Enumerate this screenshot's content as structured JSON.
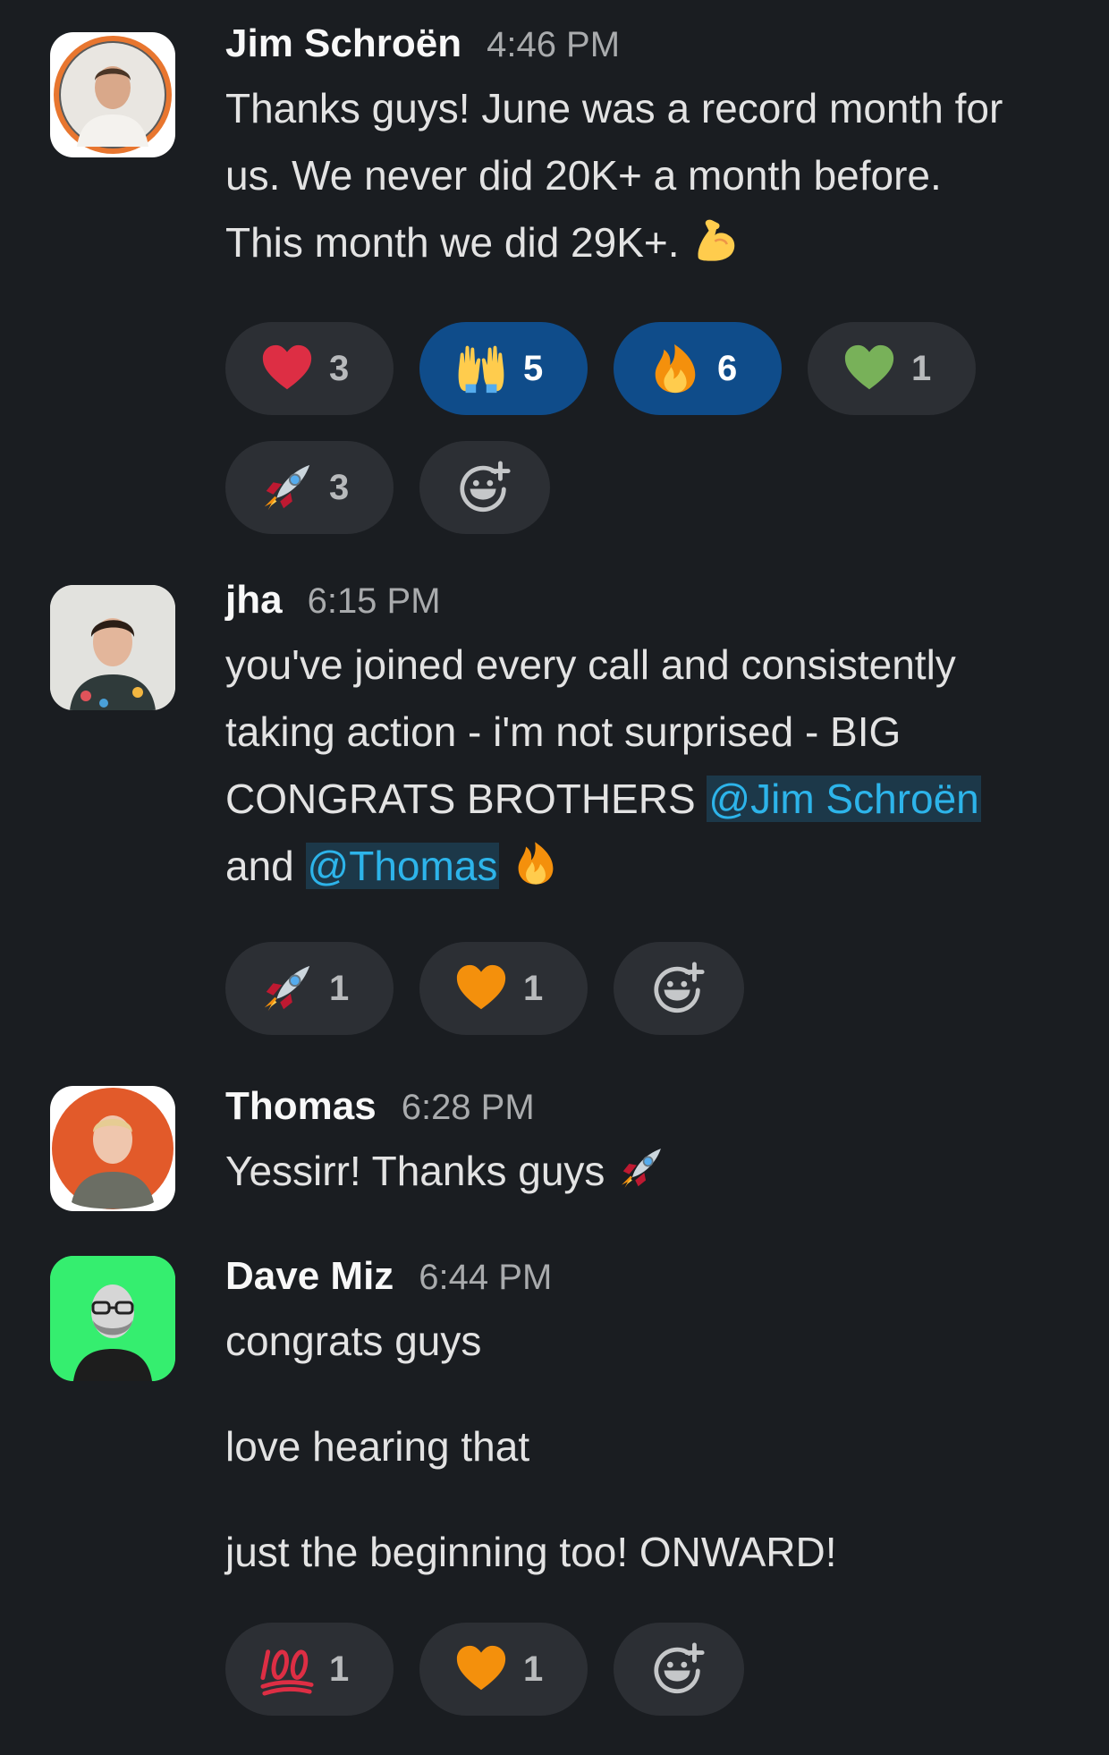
{
  "messages": [
    {
      "author": "Jim Schroën",
      "time": "4:46 PM",
      "lines": [
        "Thanks guys! June was a record month for",
        "us. We never did 20K+ a month before.",
        "This month we did 29K+."
      ],
      "trailing_emoji": "flexed-biceps",
      "reactions": [
        {
          "emoji": "red-heart",
          "count": "3",
          "active": false
        },
        {
          "emoji": "raising-hands",
          "count": "5",
          "active": true
        },
        {
          "emoji": "fire",
          "count": "6",
          "active": true
        },
        {
          "emoji": "green-heart",
          "count": "1",
          "active": false
        },
        {
          "emoji": "rocket",
          "count": "3",
          "active": false
        }
      ]
    },
    {
      "author": "jha",
      "time": "6:15 PM",
      "lines": [
        "you've joined every call and consistently",
        "taking action - i'm not surprised - BIG",
        "CONGRATS BROTHERS"
      ],
      "mention_1": "@Jim Schroën",
      "line_4_prefix": "and",
      "mention_2": "@Thomas",
      "trailing_emoji": "fire",
      "reactions": [
        {
          "emoji": "rocket",
          "count": "1",
          "active": false
        },
        {
          "emoji": "orange-heart",
          "count": "1",
          "active": false
        }
      ]
    },
    {
      "author": "Thomas",
      "time": "6:28 PM",
      "lines": [
        "Yessirr! Thanks guys"
      ],
      "trailing_emoji": "rocket"
    },
    {
      "author": "Dave Miz",
      "time": "6:44 PM",
      "lines": [
        "congrats guys",
        "love hearing that",
        "just the beginning too!  ONWARD!"
      ],
      "reactions": [
        {
          "emoji": "hundred-points",
          "count": "1",
          "active": false
        },
        {
          "emoji": "orange-heart",
          "count": "1",
          "active": false
        }
      ]
    }
  ],
  "add_reaction_icon": "add-reaction-icon",
  "colors": {
    "background": "#1a1d21",
    "pill": "#2c2f34",
    "pill_active": "#0f4c8a",
    "mention_bg": "#1c3849",
    "mention_text": "#2db4ea"
  }
}
